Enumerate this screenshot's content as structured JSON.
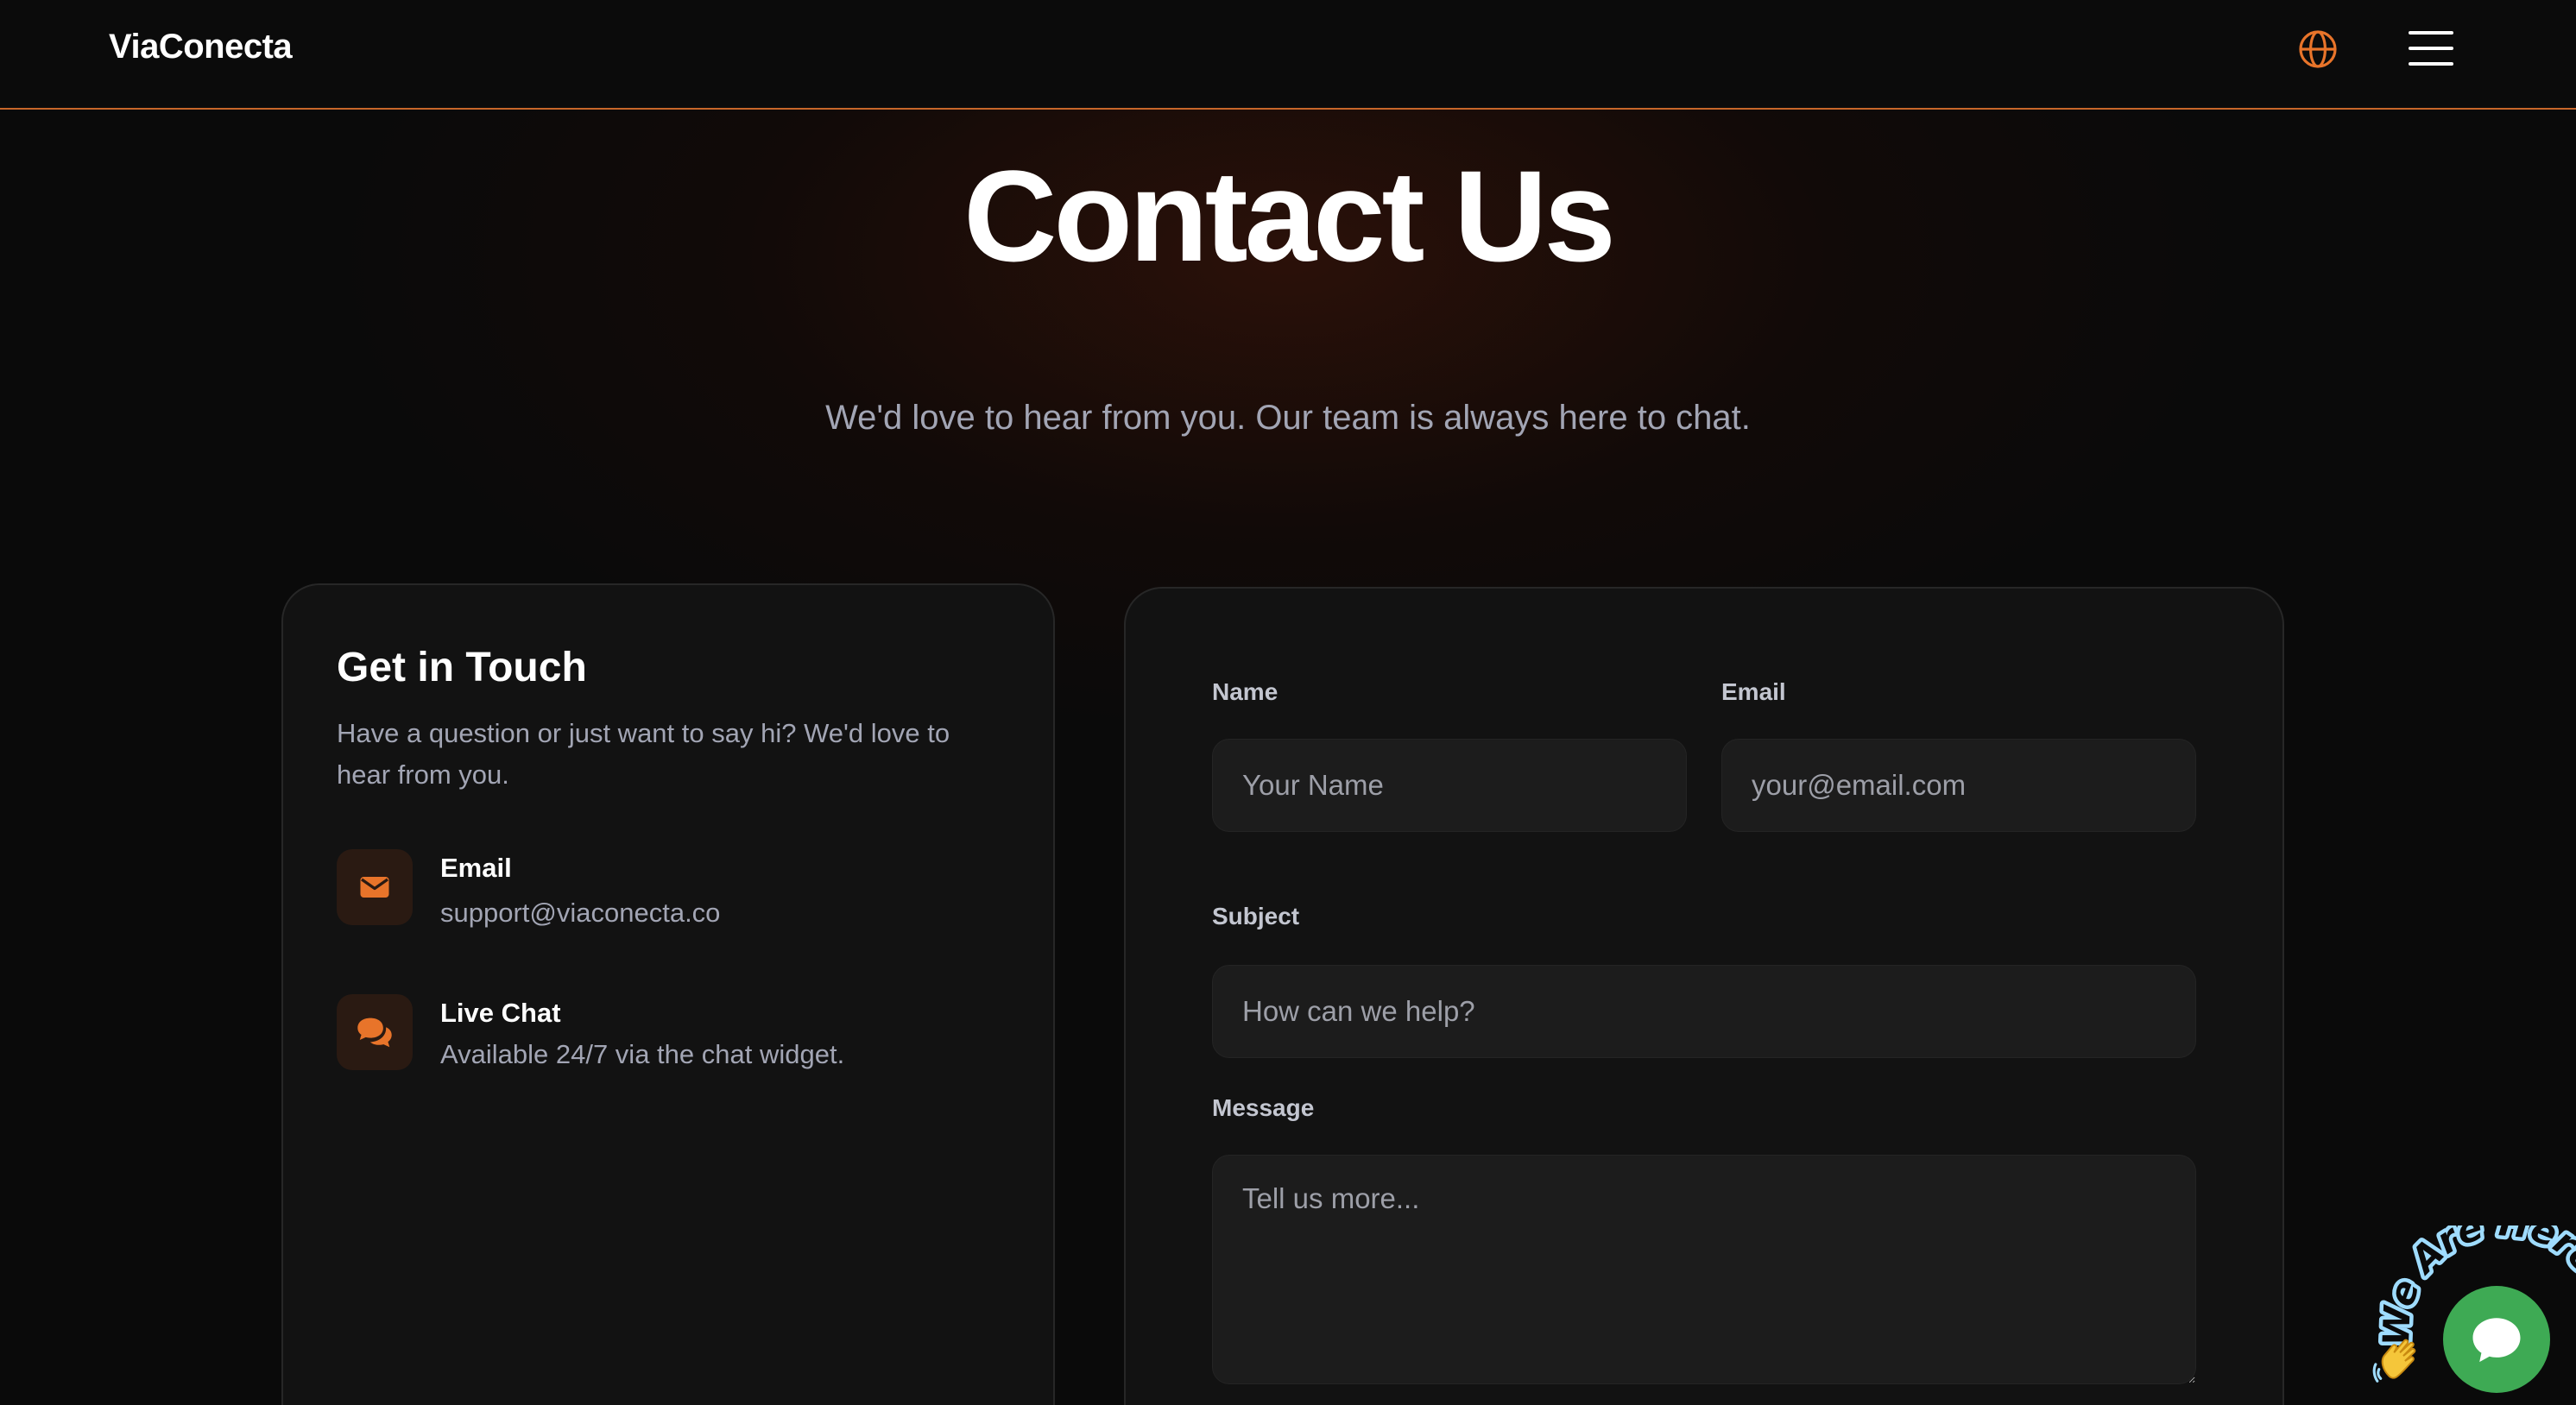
{
  "header": {
    "brand": "ViaConecta",
    "accent_color": "#e8742a",
    "icons": {
      "language": "globe-icon",
      "menu": "hamburger-menu-icon"
    }
  },
  "hero": {
    "title": "Contact Us",
    "subtitle": "We'd love to hear from you. Our team is always here to chat."
  },
  "info_card": {
    "title": "Get in Touch",
    "description": "Have a question or just want to say hi? We'd love to hear from you.",
    "items": [
      {
        "icon": "envelope-icon",
        "title": "Email",
        "value": "support@viaconecta.co"
      },
      {
        "icon": "chat-bubbles-icon",
        "title": "Live Chat",
        "value": "Available 24/7 via the chat widget."
      }
    ]
  },
  "form": {
    "name": {
      "label": "Name",
      "placeholder": "Your Name",
      "value": ""
    },
    "email": {
      "label": "Email",
      "placeholder": "your@email.com",
      "value": ""
    },
    "subject": {
      "label": "Subject",
      "placeholder": "How can we help?",
      "value": ""
    },
    "message": {
      "label": "Message",
      "placeholder": "Tell us more...",
      "value": ""
    }
  },
  "chat_widget": {
    "label": "We Are Here!",
    "icon": "chat-bubble-icon",
    "color": "#3eaa54"
  }
}
